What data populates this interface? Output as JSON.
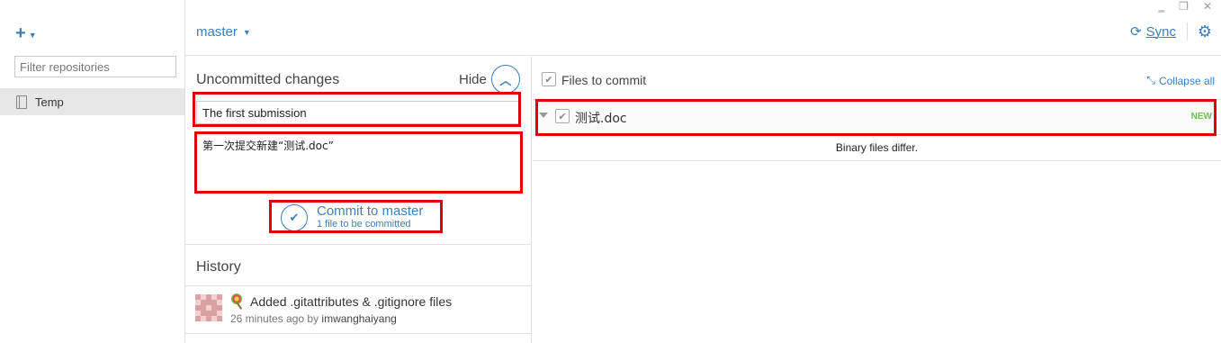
{
  "sidebar": {
    "add_icon": "plus-icon",
    "filter_placeholder": "Filter repositories",
    "repositories": [
      {
        "label": "Temp",
        "icon": "repo-icon"
      }
    ]
  },
  "header": {
    "branch": "master",
    "sync_label": "Sync",
    "window_controls": [
      "minimize-icon",
      "restore-icon",
      "close-icon"
    ]
  },
  "uncommitted": {
    "title": "Uncommitted changes",
    "hide_label": "Hide",
    "summary_value": "The first submission",
    "description_value": "第一次提交新建“测试.doc”",
    "commit_label": "Commit to master",
    "commit_sub": "1 file to be committed"
  },
  "history": {
    "title": "History",
    "items": [
      {
        "message": "Added .gitattributes & .gitignore files",
        "time": "26 minutes ago by",
        "author": "imwanghaiyang"
      }
    ]
  },
  "files": {
    "header_label": "Files to commit",
    "collapse_label": "Collapse all",
    "items": [
      {
        "name": "测试.doc",
        "badge": "NEW"
      }
    ],
    "diff_message": "Binary files differ."
  },
  "colors": {
    "accent": "#3b7fbf",
    "annotation": "#e00000",
    "new_badge": "#6cc04a"
  }
}
